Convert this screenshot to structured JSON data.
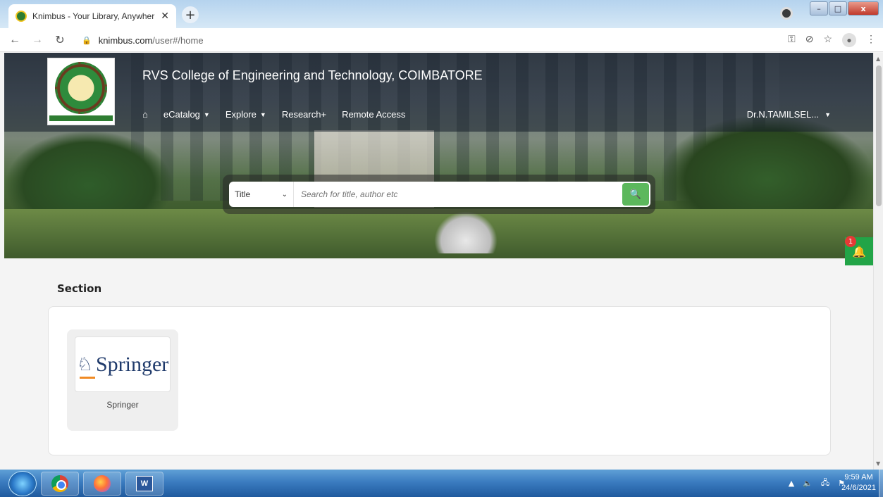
{
  "browser": {
    "tab_title": "Knimbus - Your Library, Anywher",
    "tab_close": "✕",
    "new_tab": "+",
    "url_domain": "knimbus.com",
    "url_path": "/user#/home",
    "window_controls": {
      "minimize": "–",
      "maximize": "□",
      "close": "x"
    }
  },
  "header": {
    "college_name": "RVS College of Engineering and Technology, COIMBATORE",
    "menu": {
      "home_icon": "home-icon",
      "items": [
        {
          "label": "eCatalog",
          "has_dropdown": true
        },
        {
          "label": "Explore",
          "has_dropdown": true
        },
        {
          "label": "Research+",
          "has_dropdown": false
        },
        {
          "label": "Remote Access",
          "has_dropdown": false
        }
      ]
    },
    "user_name": "Dr.N.TAMILSEL..."
  },
  "search": {
    "field_selected": "Title",
    "placeholder": "Search for title, author etc",
    "button_icon": "search-icon"
  },
  "notification": {
    "count": "1",
    "icon": "bell-icon",
    "color": "#22a447"
  },
  "section": {
    "title": "Section",
    "tiles": [
      {
        "logo_text": "Springer",
        "caption": "Springer"
      }
    ]
  },
  "taskbar": {
    "time": "9:59 AM",
    "date": "24/6/2021",
    "apps": [
      "chrome",
      "firefox",
      "word"
    ]
  },
  "colors": {
    "accent_green": "#5cb85c",
    "springer_blue": "#1f3a6b",
    "badge_red": "#e53935"
  }
}
